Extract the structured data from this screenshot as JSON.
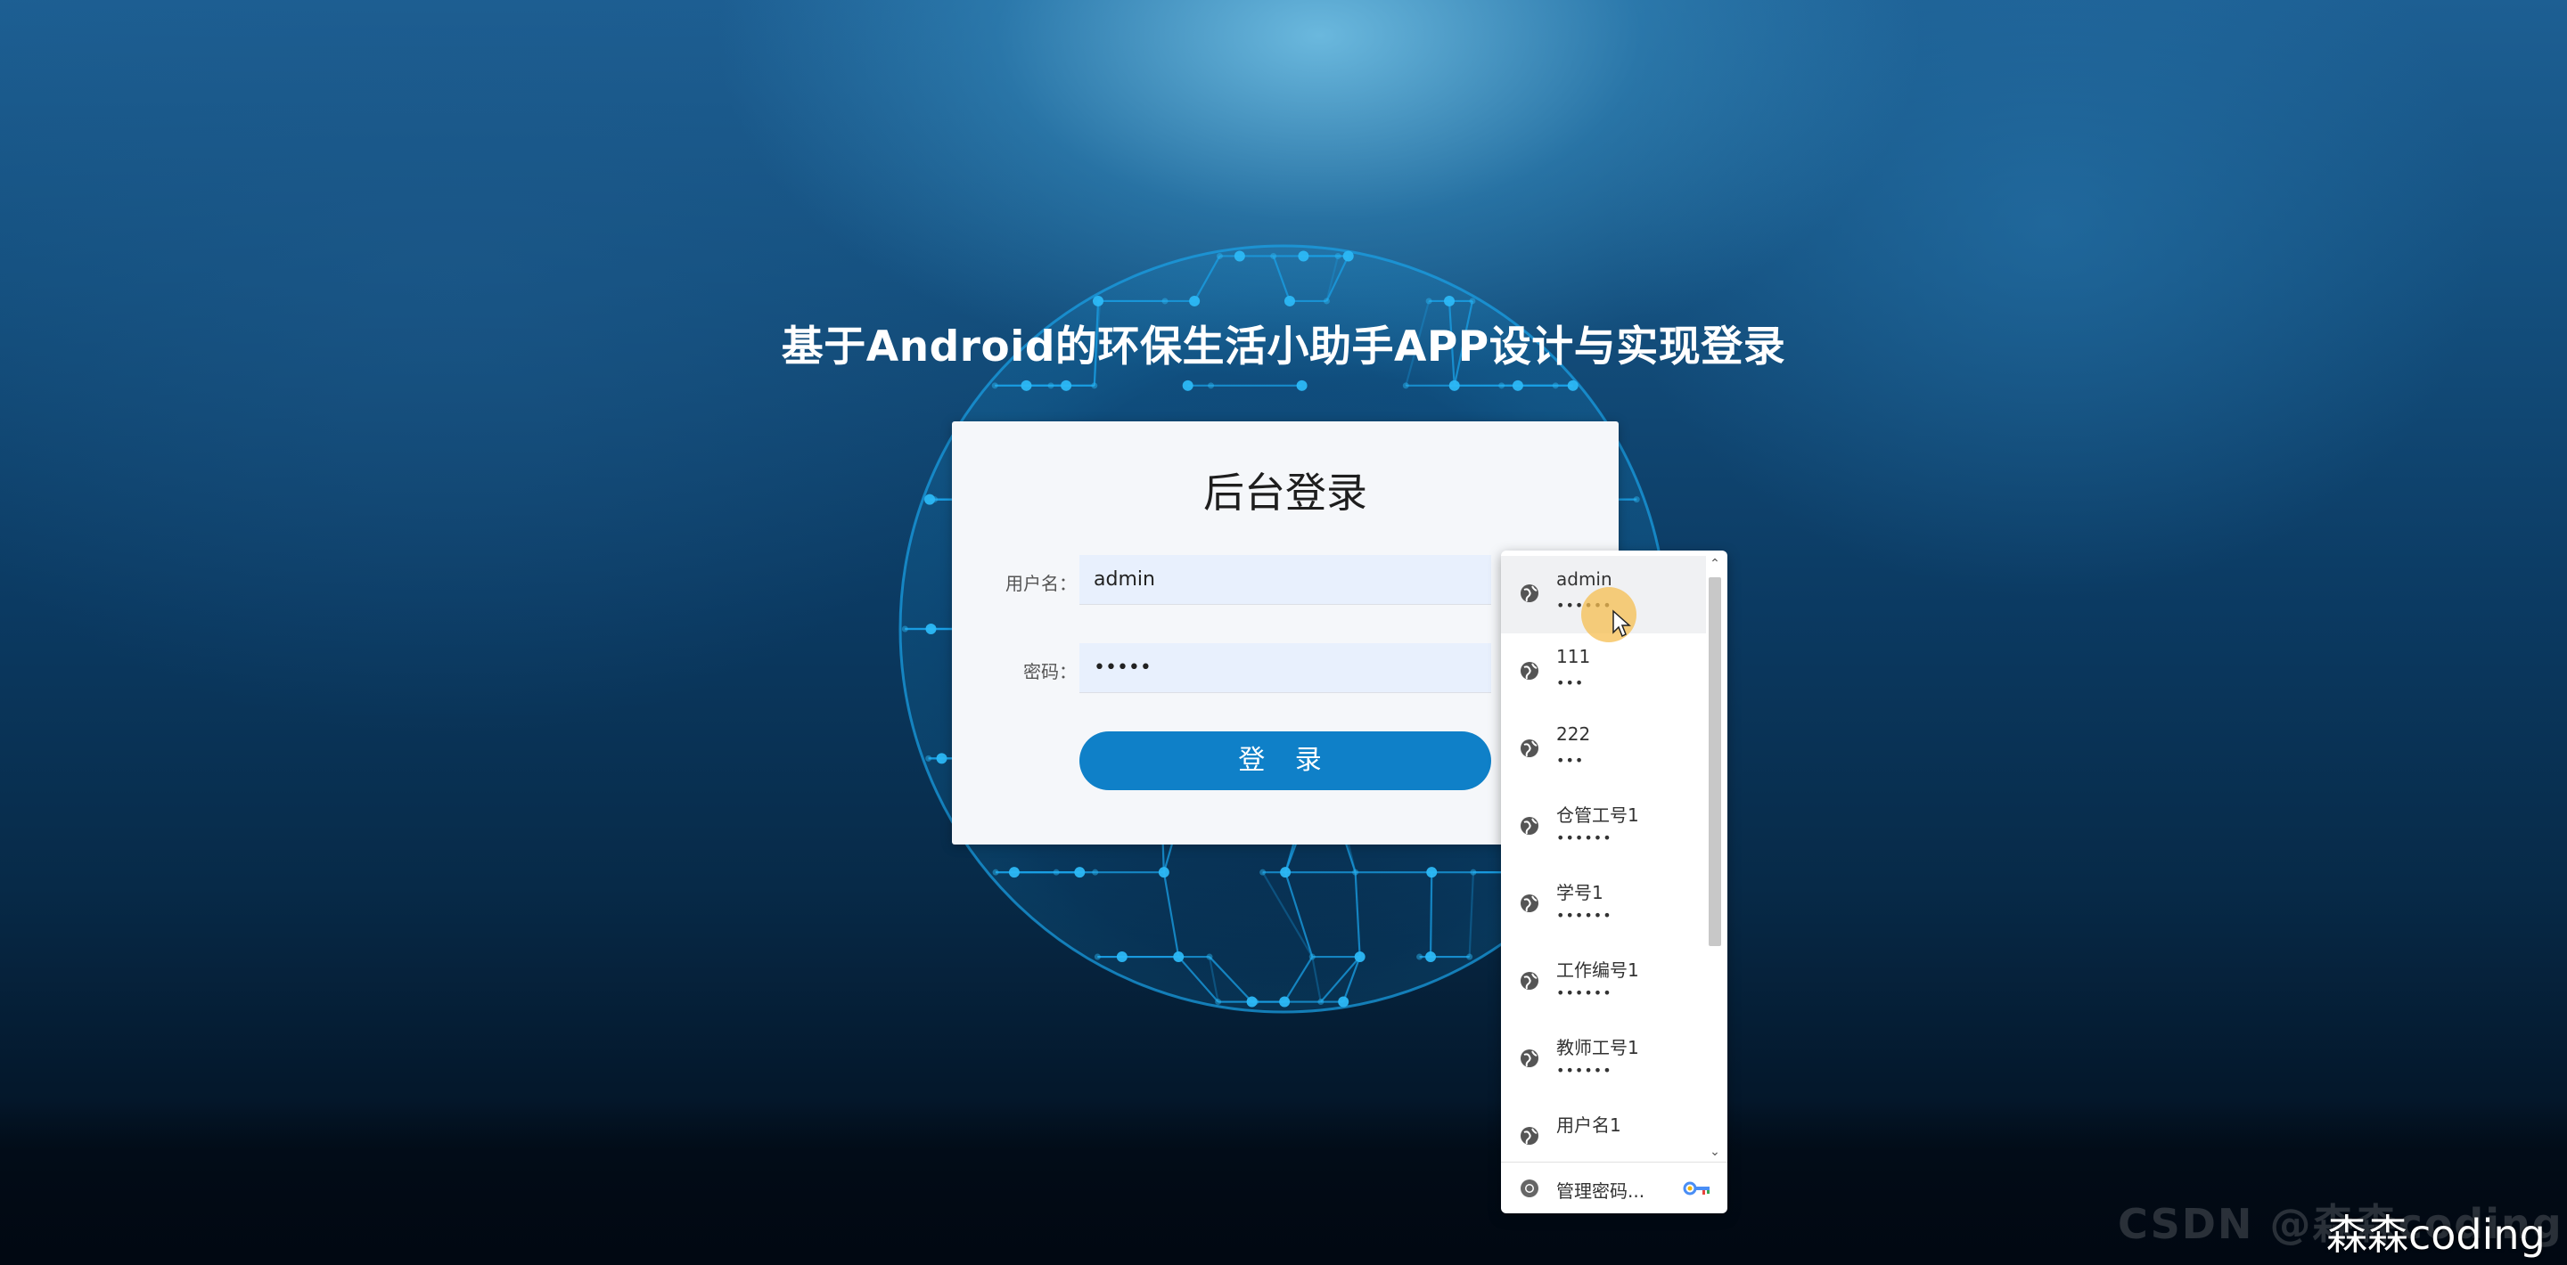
{
  "page": {
    "headline": "基于Android的环保生活小助手APP设计与实现登录"
  },
  "login_card": {
    "title": "后台登录",
    "username_label": "用户名：",
    "username_value": "admin",
    "password_label": "密码：",
    "password_value": "•••••",
    "submit_label": "登 录"
  },
  "autofill_dropdown": {
    "items": [
      {
        "username": "admin",
        "password": "••••••"
      },
      {
        "username": "111",
        "password": "•••"
      },
      {
        "username": "222",
        "password": "•••"
      },
      {
        "username": "仓管工号1",
        "password": "••••••"
      },
      {
        "username": "学号1",
        "password": "••••••"
      },
      {
        "username": "工作编号1",
        "password": "••••••"
      },
      {
        "username": "教师工号1",
        "password": "••••••"
      },
      {
        "username": "用户名1",
        "password": ""
      }
    ],
    "manage_label": "管理密码..."
  },
  "watermark": {
    "faint": "CSDN @森森coding",
    "main": "森森coding"
  },
  "colors": {
    "accent": "#0f80c8",
    "input_bg": "#e8f0fd",
    "card_bg": "#f5f7fa",
    "globe_line": "#1aa0e6"
  }
}
